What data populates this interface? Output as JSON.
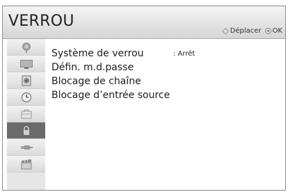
{
  "header": {
    "title": "VERROU",
    "hint_move": "Déplacer",
    "hint_ok": "OK"
  },
  "sidebar": {
    "items": [
      {
        "icon": "satellite-dish-icon"
      },
      {
        "icon": "tv-screen-icon"
      },
      {
        "icon": "speaker-icon"
      },
      {
        "icon": "clock-icon"
      },
      {
        "icon": "briefcase-icon"
      },
      {
        "icon": "lock-icon",
        "active": true
      },
      {
        "icon": "plug-icon"
      },
      {
        "icon": "clapperboard-icon"
      }
    ]
  },
  "menu": {
    "items": [
      {
        "label": "Système de verrou",
        "value": ": Arrêt"
      },
      {
        "label": "Défin. m.d.passe"
      },
      {
        "label": "Blocage de chaîne"
      },
      {
        "label": "Blocage d’entrée source"
      }
    ]
  },
  "colors": {
    "active_item": "#6b6b6b",
    "sidebar_bg": "#e6e6e6"
  }
}
